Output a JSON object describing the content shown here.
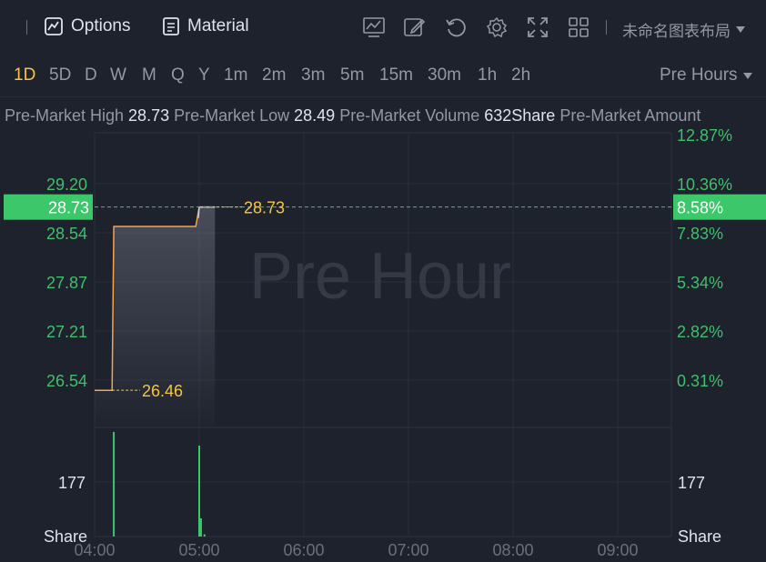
{
  "toolbar": {
    "options_label": "Options",
    "material_label": "Material",
    "layout_name": "未命名图表布局"
  },
  "periods": [
    "1D",
    "5D",
    "D",
    "W",
    "M",
    "Q",
    "Y",
    "1m",
    "2m",
    "3m",
    "5m",
    "15m",
    "30m",
    "1h",
    "2h"
  ],
  "active_period": "1D",
  "session_label": "Pre Hours",
  "stats": [
    {
      "label": "Pre-Market High",
      "value": "28.73"
    },
    {
      "label": "Pre-Market Low",
      "value": "28.49"
    },
    {
      "label": "Pre-Market Volume",
      "value": "632Share"
    },
    {
      "label": "Pre-Market Amount",
      "value": ""
    }
  ],
  "colors": {
    "background": "#1e222d",
    "price_line": "#f5a452",
    "axis_text": "#3fbf6a",
    "current_badge": "#3cc76b",
    "volume": "#3cc76b",
    "accent_text": "#f5c542"
  },
  "chart_data": {
    "type": "line",
    "watermark": "Pre Hour",
    "x_ticks": [
      "04:00",
      "05:00",
      "06:00",
      "07:00",
      "08:00",
      "09:00"
    ],
    "price_axis": {
      "ticks": [
        29.2,
        28.54,
        27.87,
        27.21,
        26.54
      ],
      "range": [
        26.0,
        29.65
      ]
    },
    "percent_axis": {
      "ticks": [
        "12.87%",
        "10.36%",
        "7.83%",
        "5.34%",
        "2.82%",
        "0.31%"
      ]
    },
    "current": {
      "price": "28.73",
      "percent": "8.58%"
    },
    "min_label": "26.46",
    "max_label": "28.73",
    "price_series": [
      {
        "t": "04:00",
        "v": 26.46
      },
      {
        "t": "04:10",
        "v": 26.46
      },
      {
        "t": "04:11",
        "v": 28.49
      },
      {
        "t": "04:58",
        "v": 28.49
      },
      {
        "t": "05:00",
        "v": 28.73
      },
      {
        "t": "05:09",
        "v": 28.73
      }
    ],
    "volume_axis": {
      "tick": "177",
      "unit": "Share",
      "max": 240
    },
    "volume_series": [
      {
        "t": "04:11",
        "v": 230
      },
      {
        "t": "05:00",
        "v": 200
      },
      {
        "t": "05:01",
        "v": 40
      },
      {
        "t": "05:03",
        "v": 5
      }
    ]
  }
}
